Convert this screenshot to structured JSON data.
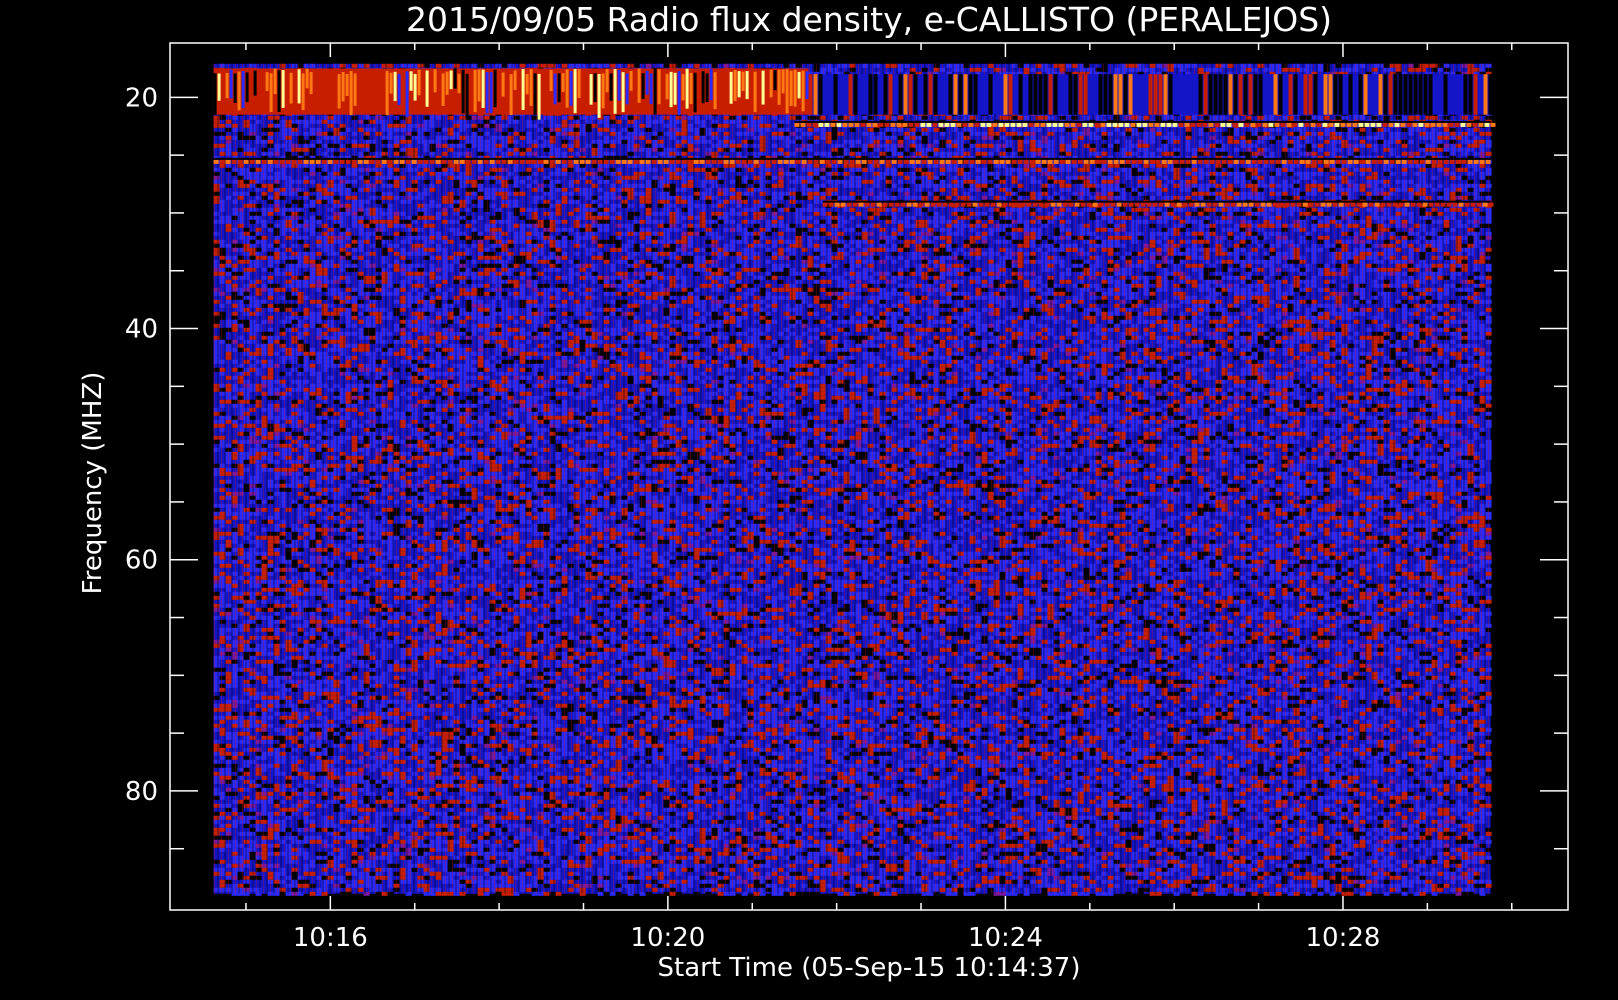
{
  "chart_data": {
    "type": "heatmap",
    "title": "2015/09/05  Radio flux density, e-CALLISTO (PERALEJOS)",
    "xlabel": "Start Time (05-Sep-15 10:14:37)",
    "ylabel": "Frequency (MHZ)",
    "x_range": [
      "10:14:37",
      "10:29:45"
    ],
    "xlim": [
      "10:14:06",
      "10:30:40"
    ],
    "ylim": [
      15.3,
      90.3
    ],
    "y_inverted": true,
    "x_ticks": [
      "10:16",
      "10:20",
      "10:24",
      "10:28"
    ],
    "x_tick_minutes": [
      16,
      20,
      24,
      28
    ],
    "y_ticks": [
      20,
      40,
      60,
      80
    ],
    "y_range": [
      17.1,
      88.9
    ],
    "colormap": [
      "#000000",
      "#1414c8",
      "#2a2aff",
      "#c81e00",
      "#ff7814",
      "#ffff96"
    ],
    "background_level": "blue",
    "emission_bands": [
      {
        "freq_from": 17.5,
        "freq_to": 21.5,
        "time_from": "10:14:37",
        "time_to": "10:21:40",
        "intensity": "high"
      },
      {
        "freq_from": 18.0,
        "freq_to": 21.5,
        "time_from": "10:21:40",
        "time_to": "10:29:45",
        "intensity": "striped-dark"
      },
      {
        "freq": 22.3,
        "time_from": "10:21:30",
        "time_to": "10:29:45",
        "intensity": "high-line"
      },
      {
        "freq": 25.5,
        "time_from": "10:14:37",
        "time_to": "10:29:45",
        "intensity": "medium-high-line"
      },
      {
        "freq": 29.2,
        "time_from": "10:21:50",
        "time_to": "10:29:45",
        "intensity": "medium-line"
      }
    ]
  }
}
